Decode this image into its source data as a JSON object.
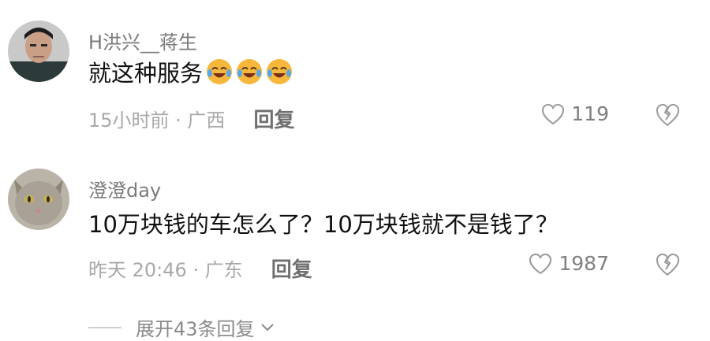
{
  "comments": [
    {
      "username": "H洪兴__蒋生",
      "text": "就这种服务",
      "emojis": [
        "laugh-cry-emoji",
        "laugh-cry-emoji",
        "laugh-cry-emoji"
      ],
      "time_location": "15小时前 · 广西",
      "reply_label": "回复",
      "likes": "119"
    },
    {
      "username": "澄澄day",
      "text": "10万块钱的车怎么了？10万块钱就不是钱了？",
      "emojis": [],
      "time_location": "昨天 20:46 · 广东",
      "reply_label": "回复",
      "likes": "1987"
    }
  ],
  "expand_replies": "展开43条回复",
  "colors": {
    "meta": "#a8a8a8",
    "username": "#7b7b7b",
    "emoji": "#f6b73c"
  }
}
